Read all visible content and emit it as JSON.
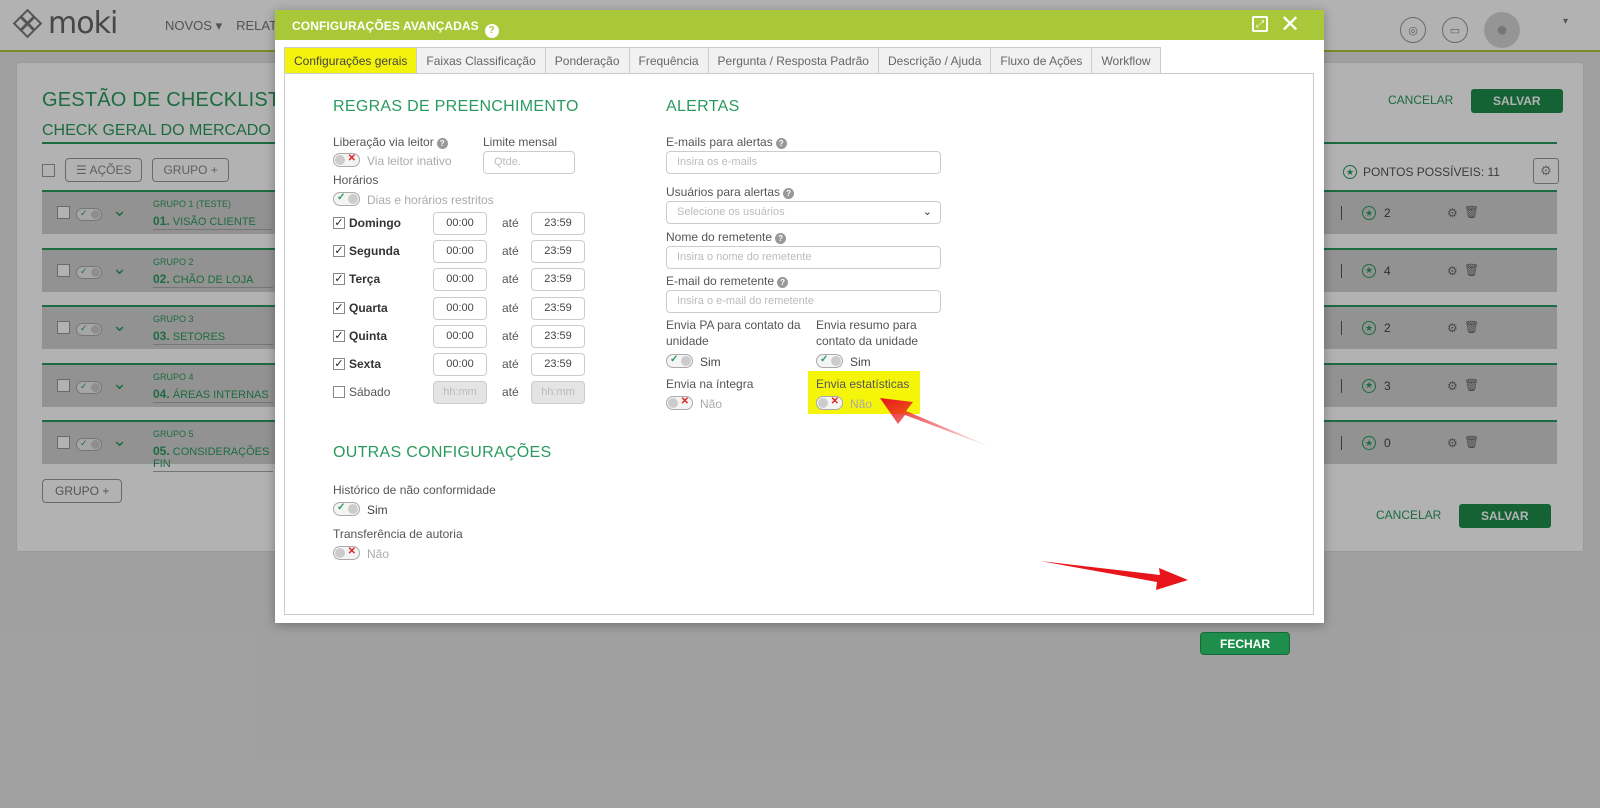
{
  "app": {
    "logo_text": "moki",
    "nav": [
      "NOVOS",
      "RELAT"
    ],
    "nav_caret": "▾"
  },
  "page": {
    "title": "GESTÃO DE CHECKLISTS",
    "subtitle": "CHECK GERAL DO MERCADO",
    "cancel_label": "CANCELAR",
    "save_label": "SALVAR",
    "actions_label": "AÇÕES",
    "group_button_label": "GRUPO",
    "points_label": "PONTOS POSSÍVEIS: 11",
    "groups": [
      {
        "label": "GRUPO 1  (TESTE)",
        "num": "01.",
        "name": "VISÃO CLIENTE",
        "points": "2"
      },
      {
        "label": "GRUPO 2",
        "num": "02.",
        "name": "CHÃO DE LOJA",
        "points": "4"
      },
      {
        "label": "GRUPO 3",
        "num": "03.",
        "name": "SETORES",
        "points": "2"
      },
      {
        "label": "GRUPO 4",
        "num": "04.",
        "name": "ÁREAS INTERNAS",
        "points": "3"
      },
      {
        "label": "GRUPO 5",
        "num": "05.",
        "name": "CONSIDERAÇÕES FIN",
        "points": "0"
      }
    ]
  },
  "modal": {
    "title": "CONFIGURAÇÕES AVANÇADAS",
    "help": "?",
    "tabs": [
      {
        "label": "Configurações gerais",
        "active": true
      },
      {
        "label": "Faixas Classificação",
        "active": false
      },
      {
        "label": "Ponderação",
        "active": false
      },
      {
        "label": "Frequência",
        "active": false
      },
      {
        "label": "Pergunta / Resposta Padrão",
        "active": false
      },
      {
        "label": "Descrição / Ajuda",
        "active": false
      },
      {
        "label": "Fluxo de Ações",
        "active": false
      },
      {
        "label": "Workflow",
        "active": false
      }
    ],
    "regras": {
      "title": "REGRAS DE PREENCHIMENTO",
      "liberacao_label": "Liberação via leitor",
      "liberacao_toggle": "Via leitor inativo",
      "limite_label": "Limite mensal",
      "limite_placeholder": "Qtde.",
      "horarios_label": "Horários",
      "horarios_toggle": "Dias e horários restritos",
      "ate": "até",
      "days": [
        {
          "name": "Domingo",
          "checked": true,
          "from": "00:00",
          "to": "23:59"
        },
        {
          "name": "Segunda",
          "checked": true,
          "from": "00:00",
          "to": "23:59"
        },
        {
          "name": "Terça",
          "checked": true,
          "from": "00:00",
          "to": "23:59"
        },
        {
          "name": "Quarta",
          "checked": true,
          "from": "00:00",
          "to": "23:59"
        },
        {
          "name": "Quinta",
          "checked": true,
          "from": "00:00",
          "to": "23:59"
        },
        {
          "name": "Sexta",
          "checked": true,
          "from": "00:00",
          "to": "23:59"
        },
        {
          "name": "Sábado",
          "checked": false,
          "from": "hh:mm",
          "to": "hh:mm"
        }
      ]
    },
    "outras": {
      "title": "OUTRAS CONFIGURAÇÕES",
      "historico_label": "Histórico de não conformidade",
      "historico_value": "Sim",
      "transferencia_label": "Transferência de autoria",
      "transferencia_value": "Não"
    },
    "alertas": {
      "title": "ALERTAS",
      "emails_label": "E-mails para alertas",
      "emails_placeholder": "Insira os e-mails",
      "usuarios_label": "Usuários para alertas",
      "usuarios_placeholder": "Selecione os usuários",
      "nome_label": "Nome do remetente",
      "nome_placeholder": "Insira o nome do remetente",
      "email_label": "E-mail do remetente",
      "email_placeholder": "Insira o e-mail do remetente",
      "envia_pa_label": "Envia PA para contato da unidade",
      "envia_pa_value": "Sim",
      "envia_resumo_label": "Envia resumo para contato da unidade",
      "envia_resumo_value": "Sim",
      "envia_integra_label": "Envia na íntegra",
      "envia_integra_value": "Não",
      "envia_estat_label": "Envia estatísticas",
      "envia_estat_value": "Não"
    },
    "close_label": "FECHAR"
  },
  "colors": {
    "brand_green": "#2a9a5e",
    "header_lime": "#a8c83a",
    "highlight_yellow": "#f5f50a",
    "arrow_red": "#e8151b"
  }
}
